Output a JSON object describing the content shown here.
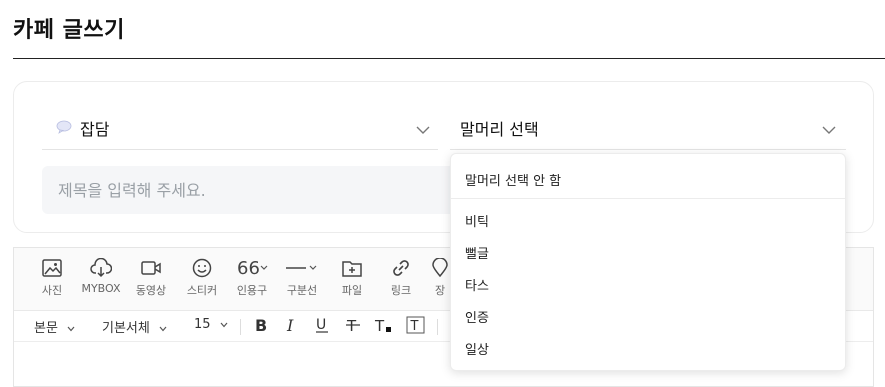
{
  "page": {
    "title": "카페 글쓰기"
  },
  "board_select": {
    "icon": "speech-bubble-icon",
    "value": "잡담"
  },
  "header_select": {
    "value": "말머리 선택"
  },
  "title_field": {
    "placeholder": "제목을 입력해 주세요.",
    "value": ""
  },
  "insert_toolbar": {
    "items": [
      {
        "icon": "photo-icon",
        "label": "사진"
      },
      {
        "icon": "cloud-upload-icon",
        "label": "MYBOX"
      },
      {
        "icon": "video-icon",
        "label": "동영상"
      },
      {
        "icon": "smiley-icon",
        "label": "스티커"
      },
      {
        "icon": "quote-icon",
        "label": "인용구"
      },
      {
        "icon": "horizontal-line-icon",
        "label": "구분선"
      },
      {
        "icon": "file-add-icon",
        "label": "파일"
      },
      {
        "icon": "link-icon",
        "label": "링크"
      },
      {
        "icon": "place-icon",
        "label": "장"
      }
    ]
  },
  "format_toolbar": {
    "paragraph_style": "본문",
    "font_family": "기본서체",
    "font_size": "15",
    "buttons": [
      "bold-icon",
      "italic-icon",
      "underline-icon",
      "strikethrough-icon",
      "text-color-icon",
      "text-background-icon"
    ]
  },
  "header_dropdown": {
    "none_option": "말머리 선택 안 함",
    "options": [
      "비틱",
      "뻘글",
      "타스",
      "인증",
      "일상"
    ]
  },
  "colors": {
    "accent_text": "#111111",
    "input_bg": "#f5f6f8",
    "divider": "#e4e4e4"
  }
}
